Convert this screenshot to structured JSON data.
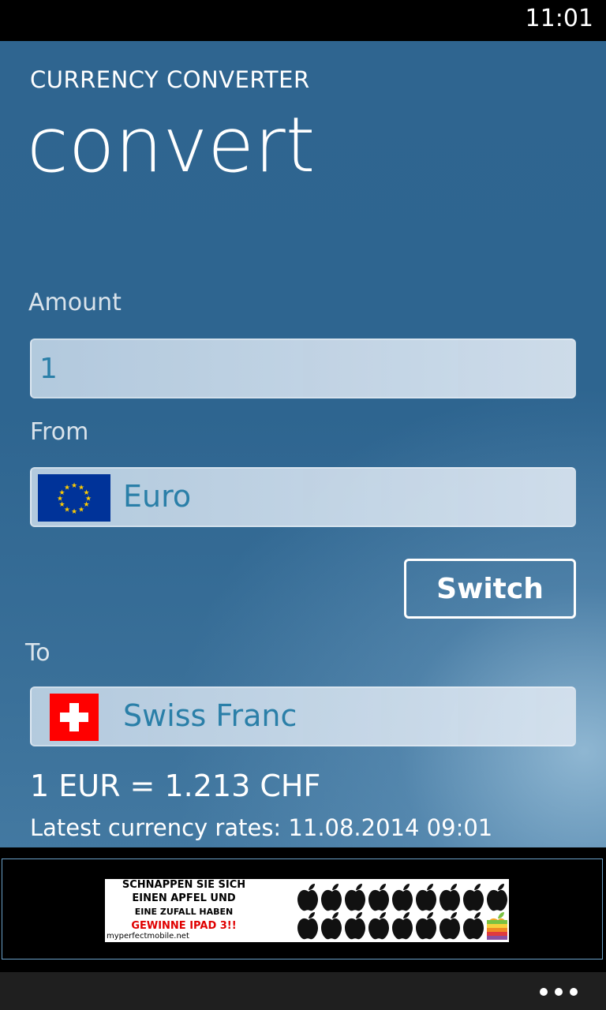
{
  "status_bar": {
    "time": "11:01"
  },
  "app": {
    "app_title": "CURRENCY CONVERTER",
    "page_title": "convert"
  },
  "form": {
    "amount_label": "Amount",
    "amount_value": "1",
    "from_label": "From",
    "from_currency": "Euro",
    "to_label": "To",
    "to_currency": "Swiss Franc",
    "switch_label": "Switch"
  },
  "result": {
    "conversion": "1 EUR = 1.213 CHF",
    "rates_updated": "Latest currency rates: 11.08.2014 09:01"
  },
  "ad": {
    "line1": "SCHNAPPEN SIE SICH",
    "line2": "EINEN APFEL UND",
    "line3": "EINE ZUFALL HABEN",
    "line4": "GEWINNE IPAD 3!!",
    "site": "myperfectmobile.net"
  },
  "colors": {
    "accent_text": "#2a7fa8",
    "background": "#2f6590",
    "eu_blue": "#003399",
    "eu_star": "#ffcc00",
    "swiss_red": "#ff0000"
  },
  "icons": {
    "from_flag": "eu-flag-icon",
    "to_flag": "swiss-flag-icon",
    "more": "more-dots-icon"
  }
}
